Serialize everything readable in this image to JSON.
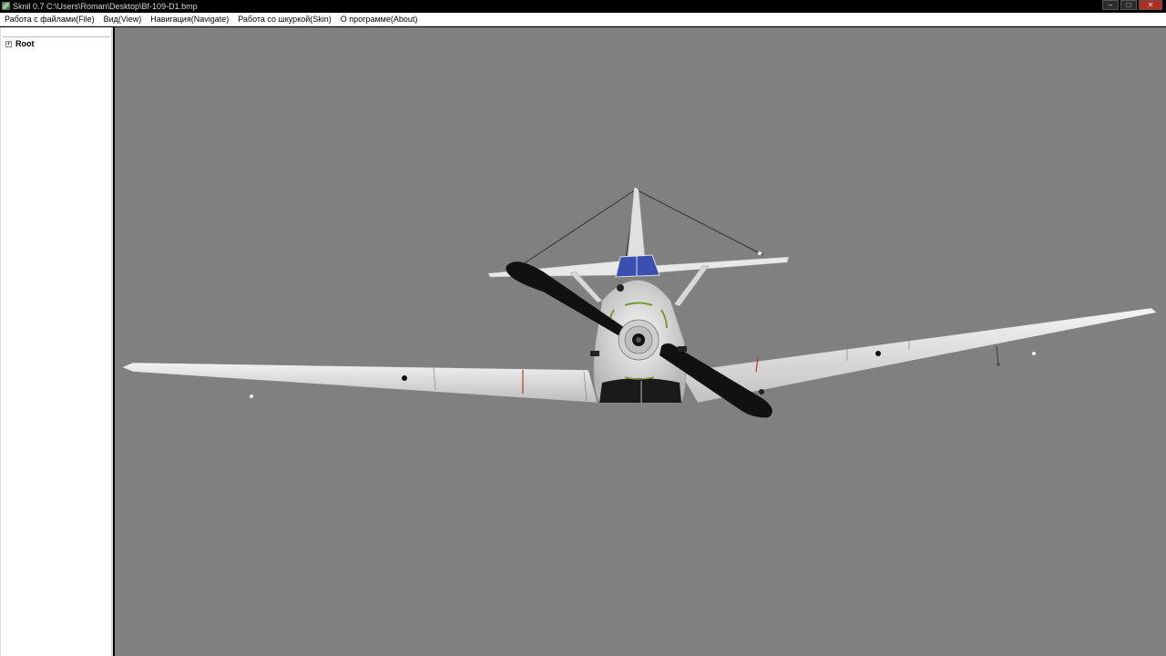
{
  "window": {
    "title": "Sknil 0.7   C:\\Users\\Roman\\Desktop\\Bf-109-D1.bmp",
    "minimize_glyph": "–",
    "maximize_glyph": "□",
    "close_glyph": "✕"
  },
  "menu": [
    {
      "label": "Работа с файлами(File)"
    },
    {
      "label": "Вид(View)"
    },
    {
      "label": "Навигация(Navigate)"
    },
    {
      "label": "Работа со шкуркой(Skin)"
    },
    {
      "label": "О программе(About)"
    }
  ],
  "tree": {
    "root": {
      "label": "Root",
      "expander": "+"
    }
  },
  "colors": {
    "viewport_bg": "#808080",
    "airframe": "#e6e6e6",
    "canopy": "#3a4fb0",
    "propeller": "#111111"
  },
  "icons": {
    "app": "app-icon",
    "expander": "plus-box-icon"
  }
}
